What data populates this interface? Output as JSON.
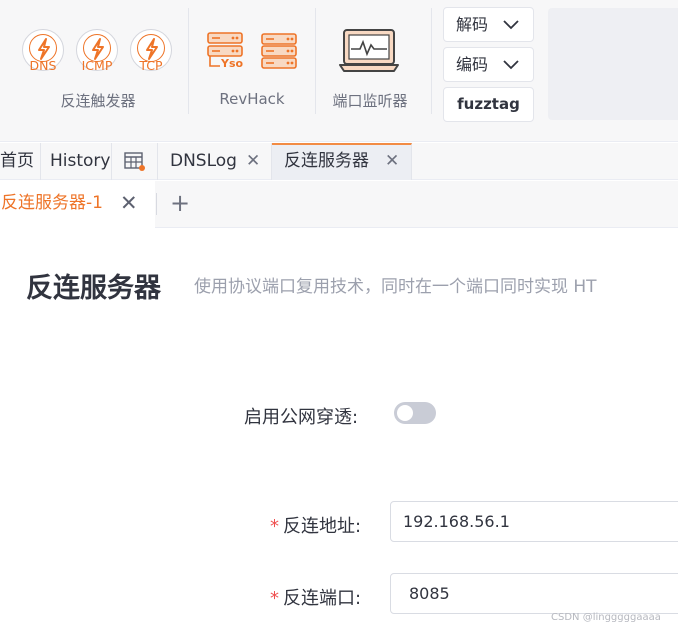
{
  "toolbar": {
    "reverse_trigger": {
      "icons": [
        {
          "label": "DNS",
          "icon": "bolt-icon"
        },
        {
          "label": "ICMP",
          "icon": "bolt-icon"
        },
        {
          "label": "TCP",
          "icon": "bolt-icon"
        }
      ],
      "group_label": "反连触发器"
    },
    "revhack": {
      "yso_label": "Yso",
      "group_label": "RevHack"
    },
    "port_monitor": {
      "group_label": "端口监听器"
    },
    "decode_label": "解码",
    "encode_label": "编码",
    "fuzztag_label": "fuzztag"
  },
  "tabs": [
    {
      "label": "首页"
    },
    {
      "label": "History"
    },
    {
      "label": "",
      "icon": "table-icon"
    },
    {
      "label": "DNSLog",
      "close": "✕"
    },
    {
      "label": "反连服务器",
      "close": "✕",
      "active": true
    }
  ],
  "subtabs": {
    "active_label": "反连服务器-1",
    "close": "✕",
    "add": "+"
  },
  "page": {
    "title": "反连服务器",
    "subtitle": "使用协议端口复用技术，同时在一个端口同时实现 HT"
  },
  "form": {
    "nat_label": "启用公网穿透",
    "nat_enabled": false,
    "host_label": "反连地址",
    "host_value": "192.168.56.1",
    "port_label": "反连端口",
    "port_value": "8085",
    "required_mark": "*",
    "colon": ":"
  },
  "watermark": "CSDN @lingggggaaaa",
  "colors": {
    "accent": "#ee7428",
    "required": "#ef4f4f",
    "text": "#31343f",
    "muted": "#9ca0ad"
  }
}
